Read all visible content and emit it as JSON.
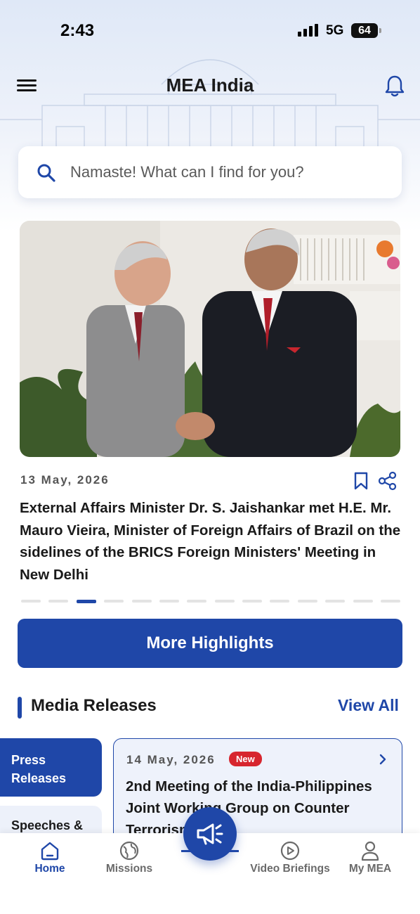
{
  "status_bar": {
    "time": "2:43",
    "network": "5G",
    "battery": "64"
  },
  "header": {
    "title": "MEA India"
  },
  "search": {
    "placeholder": "Namaste! What can I find for you?"
  },
  "highlight": {
    "date": "13 May, 2026",
    "title": "External Affairs Minister Dr. S. Jaishankar met H.E. Mr. Mauro Vieira, Minister of Foreign Affairs of Brazil on the sidelines of the BRICS Foreign Ministers' Meeting in New Delhi",
    "carousel_total": 14,
    "carousel_active_index": 2
  },
  "more_highlights_label": "More Highlights",
  "media_releases": {
    "title": "Media Releases",
    "view_all": "View All",
    "tabs": [
      {
        "label": "Press Releases"
      },
      {
        "label": "Speeches &"
      }
    ],
    "card": {
      "date": "14 May, 2026",
      "badge": "New",
      "title": "2nd Meeting of the India-Philippines Joint Working Group on Counter Terrorism"
    }
  },
  "bottom_nav": {
    "items": [
      {
        "label": "Home"
      },
      {
        "label": "Missions"
      },
      {
        "label": "Video Briefings"
      },
      {
        "label": "My MEA"
      }
    ]
  },
  "colors": {
    "primary": "#1f47a8",
    "badge_red": "#d7262e"
  }
}
